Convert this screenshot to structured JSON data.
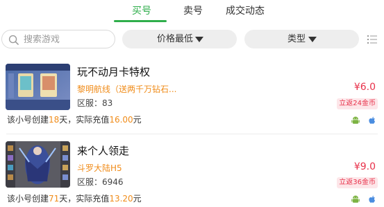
{
  "tabs": [
    {
      "label": "买号",
      "active": true
    },
    {
      "label": "卖号",
      "active": false
    },
    {
      "label": "成交动态",
      "active": false
    }
  ],
  "colors": {
    "accent": "#2fae4b",
    "price": "#e8314a",
    "highlight": "#f08c1a"
  },
  "filter": {
    "search_placeholder": "搜索游戏",
    "sort_label": "价格最低",
    "type_label": "类型",
    "search_icon": "search-icon",
    "list_icon": "list-icon"
  },
  "listings": [
    {
      "title": "玩不动月卡特权",
      "game": "黎明航线（送两千万钻石...",
      "server": "区服：83",
      "price": "¥6.0",
      "rebate": "立返24金币",
      "meta": {
        "prefix": "该小号创建",
        "days": "18",
        "mid": "天，实际充值",
        "amount": "16.00",
        "suffix": "元"
      },
      "platforms": [
        "android-icon",
        "apple-icon"
      ]
    },
    {
      "title": "来个人领走",
      "game": "斗罗大陆H5",
      "server": "区服：6946",
      "price": "¥9.0",
      "rebate": "立返36金币",
      "meta": {
        "prefix": "该小号创建",
        "days": "71",
        "mid": "天，实际充值",
        "amount": "13.20",
        "suffix": "元"
      },
      "platforms": [
        "android-icon",
        "apple-icon"
      ]
    }
  ]
}
